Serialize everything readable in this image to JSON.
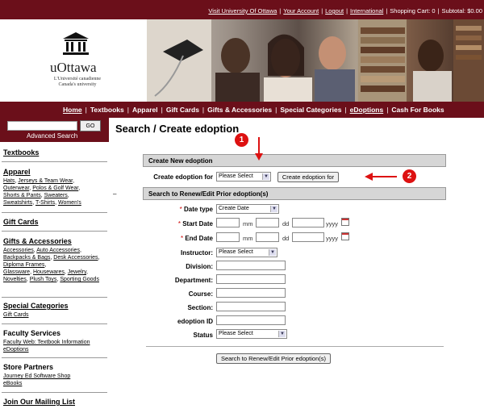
{
  "topbar": {
    "links": [
      "Visit University Of Ottawa",
      "Your Account",
      "Logout",
      "International"
    ],
    "shopping_cart": "Shopping Cart: 0",
    "subtotal": "Subtotal: $0.00"
  },
  "header": {
    "logo_name": "uOttawa",
    "logo_sub_1": "L'Université canadienne",
    "logo_sub_2": "Canada's university"
  },
  "nav": {
    "items": [
      "Home",
      "Textbooks",
      "Apparel",
      "Gift Cards",
      "Gifts & Accessories",
      "Special Categories",
      "eDoptions",
      "Cash For Books"
    ]
  },
  "sidebar": {
    "go_label": "GO",
    "advanced_search": "Advanced Search",
    "textbooks": "Textbooks",
    "apparel": "Apparel",
    "apparel_links": [
      "Hats",
      "Jerseys & Team Wear",
      "Outerwear",
      "Polos & Golf Wear",
      "Shorts & Pants",
      "Sweaters",
      "Sweatshirts",
      "T-Shirts",
      "Women's"
    ],
    "gift_cards": "Gift Cards",
    "gifts": "Gifts & Accessories",
    "gifts_links": [
      "Accessories",
      "Auto Accessories",
      "Backpacks & Bags",
      "Desk Accessories",
      "Diploma Frames",
      "Glassware",
      "Housewares",
      "Jewelry",
      "Novelties",
      "Plush Toys",
      "Sporting Goods"
    ],
    "special": "Special Categories",
    "special_links": [
      "Gift Cards"
    ],
    "faculty": "Faculty Services",
    "faculty_links": [
      "Faculty Web: Textbook Information",
      "eDoptions"
    ],
    "store": "Store Partners",
    "store_links": [
      "Journey Ed Software Shop",
      "eBooks"
    ],
    "mailing": "Join Our Mailing List"
  },
  "main": {
    "title": "Search / Create edoption",
    "create_header": "Create New edoption",
    "create_for_label": "Create edoption for",
    "create_for_value": "Please Select",
    "create_button": "Create edoption for",
    "search_header": "Search to Renew/Edit Prior edoption(s)",
    "date_type_label": "Date type",
    "date_type_value": "Create Date",
    "start_date_label": "Start Date",
    "end_date_label": "End Date",
    "mm": "mm",
    "dd": "dd",
    "yyyy": "yyyy",
    "instructor_label": "Instructor:",
    "instructor_value": "Please Select",
    "division_label": "Division:",
    "department_label": "Department:",
    "course_label": "Course:",
    "section_label": "Section:",
    "edoption_id_label": "edoption ID",
    "status_label": "Status",
    "status_value": "Please Select",
    "search_button": "Search to Renew/Edit Prior edoption(s)",
    "required_mark": "*"
  },
  "callouts": {
    "one": "1",
    "two": "2"
  },
  "colors": {
    "maroon": "#6b0f1a",
    "callout_red": "#d11111"
  }
}
